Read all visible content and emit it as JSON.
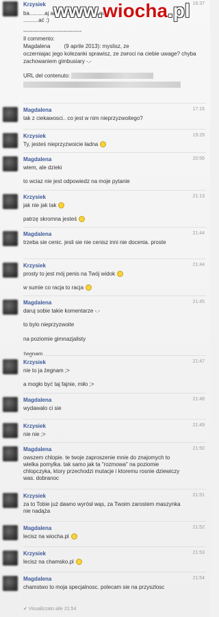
{
  "watermark": {
    "pre": "www.",
    "brand": "wiocha",
    "post": ".pl"
  },
  "top": {
    "author": "Krzysiek",
    "time": "16:37",
    "first_text": "ba..........aj    arz.......nuszę, abyś go",
    "first_text2": "..........ać :)",
    "divider": "--------------------------------",
    "quote_header": "Il commento:",
    "quote_author": "Magdalena",
    "quote_date": "(9 aprile 2013): myslisz, ze",
    "quote_body": "oczerniajac jego kolezanki sprawisz, ze zwroci na ciebie uwage? chyba zachowaniem gimbusiary -.-",
    "url_label": "URL del contenuto:"
  },
  "messages": [
    {
      "author": "Magdalena",
      "time": "17:15",
      "lines": [
        "tak z ciekawosci.. co jest w nim nieprzyzwoitego?"
      ]
    },
    {
      "author": "Krzysiek",
      "time": "19:29",
      "lines": [
        "Ty, jesteś nieprzyzwoicie ładna"
      ]
    },
    {
      "author": "Magdalena",
      "time": "20:56",
      "lines": [
        "wiem, ale dzieki",
        "to wciaz nie jest odpowiedz na moje pytanie"
      ]
    },
    {
      "author": "Krzysiek",
      "time": "21:13",
      "lines": [
        "jak nie jak tak",
        "patrzę skromna jesteś"
      ]
    },
    {
      "author": "Magdalena",
      "time": "21:44",
      "lines": [
        "trzeba sie cenic. jesli sie nie cenisz inni nie docenia. proste"
      ]
    },
    {
      "author": "Krzysiek",
      "time": "21:44",
      "lines": [
        "prosty to jest mój penis na Twój widok",
        "w sumie co racja to racja"
      ]
    },
    {
      "author": "Magdalena",
      "time": "21:45",
      "lines": [
        "daruj sobie takie komentarze -.-",
        "to bylo nieprzyzwoite",
        "na poziomie gimnazjalisty",
        "żegnam"
      ]
    },
    {
      "author": "Krzysiek",
      "time": "21:47",
      "lines": [
        "nie to ja żegnam ;>",
        "a mogło być taj fajnie, miło ;>"
      ]
    },
    {
      "author": "Magdalena",
      "time": "21:48",
      "lines": [
        "wydawalo ci sie"
      ]
    },
    {
      "author": "Krzysiek",
      "time": "21:49",
      "lines": [
        "nie nie ;>"
      ]
    },
    {
      "author": "Magdalena",
      "time": "21:50",
      "lines": [
        "owszem chlopie. te twoje zaproszenie mnie do znajomych to wielka pomylka. tak samo jak ta \"rozmowa\" na poziomie chlopczyka, ktory przechodzi mutacje i ktoremu rosnie dziewiczy was. dobranoc"
      ]
    },
    {
      "author": "Krzysiek",
      "time": "21:51",
      "lines": [
        "za to Tobie już dawno wyrósł wąs, za Twoim zarostem maszynka nie nadąża"
      ]
    },
    {
      "author": "Magdalena",
      "time": "21:52",
      "lines": [
        "lecisz na wiocha.pl"
      ]
    },
    {
      "author": "Krzysiek",
      "time": "21:53",
      "lines": [
        "lecisz na chamsko.pl"
      ]
    },
    {
      "author": "Magdalena",
      "time": "21:54",
      "lines": [
        "chamstwo to moja specjalnosc. polecam sie na przyszlosc"
      ]
    }
  ],
  "seen": "Visualizzato alle 21:54",
  "icons": {
    "emoticon": "smiley-icon",
    "check": "check-icon"
  }
}
